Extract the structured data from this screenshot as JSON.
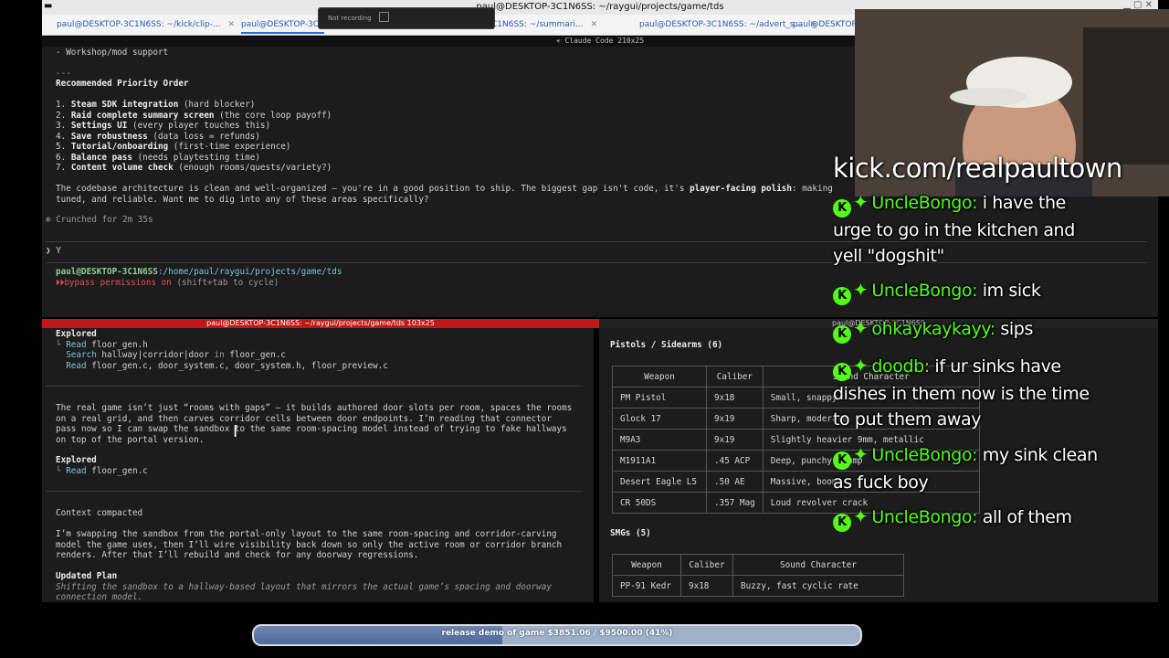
{
  "window": {
    "title": "paul@DESKTOP-3C1N6SS: ~/raygui/projects/game/tds"
  },
  "tabs": [
    {
      "label": "paul@DESKTOP-3C1N6SS: ~/kick/clip-..."
    },
    {
      "label": "paul@DESKTOP-3C1"
    },
    {
      "label": "C1N6SS: ~/summari..."
    },
    {
      "label": "paul@DESKTOP-3C1N6SS: ~/advert_s..."
    },
    {
      "label": "paul@DESKTOP-3C1"
    }
  ],
  "recording": {
    "status": "Not recording"
  },
  "top_pane": {
    "subtitle": "✳ Claude Code 210x25",
    "line_workshop": "- Workshop/mod support",
    "line_dashes": "---",
    "heading": "Recommended Priority Order",
    "priorities": [
      {
        "num": "1.",
        "title": "Steam SDK integration",
        "note": " (hard blocker)"
      },
      {
        "num": "2.",
        "title": "Raid complete summary screen",
        "note": " (the core loop payoff)"
      },
      {
        "num": "3.",
        "title": "Settings UI",
        "note": " (every player touches this)"
      },
      {
        "num": "4.",
        "title": "Save robustness",
        "note": " (data loss = refunds)"
      },
      {
        "num": "5.",
        "title": "Tutorial/onboarding",
        "note": " (first-time experience)"
      },
      {
        "num": "6.",
        "title": "Balance pass",
        "note": " (needs playtesting time)"
      },
      {
        "num": "7.",
        "title": "Content volume check",
        "note": " (enough rooms/quests/variety?)"
      }
    ],
    "summary_a": "The codebase architecture is clean and well-organized — you're in a good position to ship. The biggest gap isn't code, it's ",
    "summary_bold": "player-facing polish",
    "summary_b": ": making",
    "summary_line2": "tuned, and reliable. Want me to dig into any of these areas specifically?",
    "crunched": "✻ Crunched for 2m 35s",
    "prompt_input": "❯ Y",
    "ps1_user": "paul@DESKTOP-3C1N6SS",
    "ps1_path": ":/home/paul/raygui/projects/game/tds",
    "bypass_icon": "⏵⏵",
    "bypass": "bypass permissions on",
    "bypass_hint": " (shift+tab to cycle)"
  },
  "left_pane": {
    "header": "paul@DESKTOP-3C1N6SS: ~/raygui/projects/game/tds 103x25",
    "explored1": "Explored",
    "r1_verb": "Read",
    "r1_arg": " floor_gen.h",
    "r2_verb": "Search",
    "r2_arg": " hallway|corridor|door",
    "r2_in": " in ",
    "r2_file": "floor_gen.c",
    "r3_verb": "Read",
    "r3_arg": " floor_gen.c, door_system.c, door_system.h, floor_preview.c",
    "para1": [
      "The real game isn’t just “rooms with gaps” — it builds authored door slots per room, spaces the rooms",
      "on a real grid, and then carves corridor cells between door endpoints. I’m reading that connector",
      "pass now so I can swap the sandbox to the same room-spacing model instead of trying to fake hallways",
      "on top of the portal version."
    ],
    "explored2": "Explored",
    "r4_verb": "Read",
    "r4_arg": " floor_gen.c",
    "compacted": "Context compacted",
    "para2": [
      "I’m swapping the sandbox from the portal-only layout to the same room-spacing and corridor-carving",
      "model the game uses, then I’ll wire visibility back down so only the active room or corridor branch",
      "renders. After that I’ll rebuild and check for any doorway regressions."
    ],
    "plan_title": "Updated Plan",
    "plan_lines": [
      "Shifting the sandbox to a hallway-based layout that mirrors the actual game’s spacing and doorway",
      "connection model."
    ]
  },
  "right_pane": {
    "header": "paul@DESKTOP-3C1N6SS",
    "pistols_title": "Pistols / Sidearms (6)",
    "columns": [
      "Weapon",
      "Caliber",
      "Sound Character"
    ],
    "pistols": [
      [
        "PM Pistol",
        "9x18",
        "Small, snappy"
      ],
      [
        "Glock 17",
        "9x19",
        "Sharp, moderate"
      ],
      [
        "M9A3",
        "9x19",
        "Slightly heavier 9mm, metallic"
      ],
      [
        "M1911A1",
        ".45 ACP",
        "Deep, punchy thump"
      ],
      [
        "Desert Eagle L5",
        ".50 AE",
        "Massive, boomy"
      ],
      [
        "CR 50DS",
        ".357 Mag",
        "Loud revolver crack"
      ]
    ],
    "smgs_title": "SMGs (5)",
    "smgs": [
      [
        "PP-91 Kedr",
        "9x18",
        "Buzzy, fast cyclic rate"
      ]
    ]
  },
  "overlay": {
    "kick_url": "kick.com/realpaultown",
    "chat": [
      {
        "user": "UncleBongo:",
        "text": " i have the urge to go in the kitchen and yell \"dogshit\""
      },
      {
        "user": "UncleBongo:",
        "text": " im sick"
      },
      {
        "user": "ohkaykaykayy:",
        "text": " sips"
      },
      {
        "user": "doodb:",
        "text": " if ur sinks have dishes in them now is the time to put them away"
      },
      {
        "user": "UncleBongo:",
        "text": " my sink clean as fuck boy"
      },
      {
        "user": "UncleBongo:",
        "text": " all of them"
      }
    ],
    "badge_letter": "K",
    "goal": {
      "text": "release demo of game $3851.06 / $9500.00 (41%)",
      "progress": 0.41
    }
  },
  "colors": {
    "accent": "#53fc18",
    "terminal_bg": "#1c1c1c",
    "active_header": "#c01818"
  }
}
